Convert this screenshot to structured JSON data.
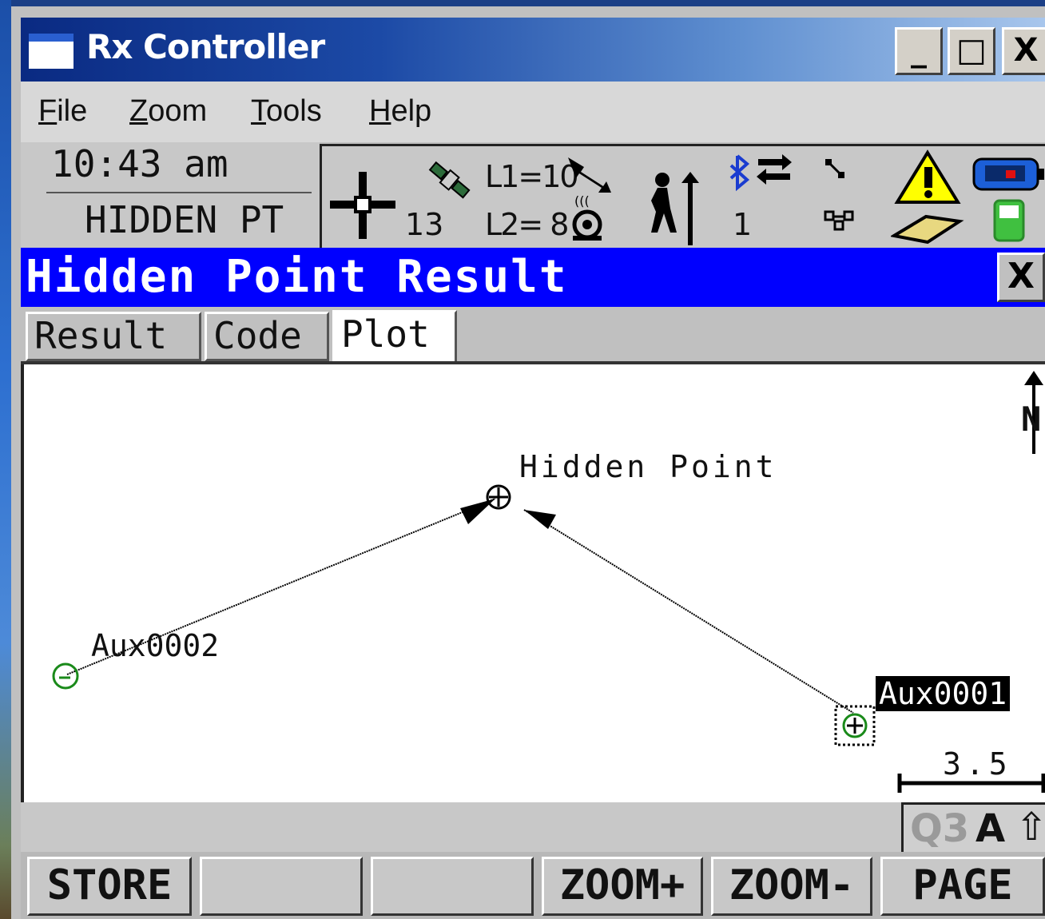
{
  "window": {
    "title": "Rx Controller",
    "minimize_label": "_",
    "maximize_label": "□",
    "close_label": "X"
  },
  "menu": [
    {
      "label": "File"
    },
    {
      "label": "Zoom"
    },
    {
      "label": "Tools"
    },
    {
      "label": "Help"
    }
  ],
  "status": {
    "time": "10:43 am",
    "mode": "HIDDEN PT",
    "satellites": "13",
    "l1": "L1=10",
    "l2": "L2= 8",
    "radio_count": "1",
    "icons": [
      "position-crosshair-icon",
      "satellite-icon",
      "radio-link-icon",
      "rover-pole-icon",
      "bluetooth-icon",
      "network-icon",
      "warning-icon",
      "battery-icon",
      "controller-icon"
    ]
  },
  "dialog": {
    "title": "Hidden Point Result",
    "close_label": "X"
  },
  "tabs": [
    {
      "label": "Result",
      "active": false
    },
    {
      "label": "Code",
      "active": false
    },
    {
      "label": "Plot",
      "active": true
    }
  ],
  "plot": {
    "north_label": "N",
    "scale_label": "3.5",
    "points": [
      {
        "name": "Hidden Point",
        "type": "computed"
      },
      {
        "name": "Aux0002",
        "type": "observed"
      },
      {
        "name": "Aux0001",
        "type": "observed",
        "selected": true
      }
    ]
  },
  "input_mode": {
    "q3": "Q3",
    "case": "A",
    "shift": "⇧"
  },
  "softkeys": [
    "STORE",
    "",
    "",
    "ZOOM+",
    "ZOOM-",
    "PAGE"
  ],
  "colors": {
    "dialog_header": "#0000ff",
    "observed_point": "#1a8a1a",
    "title_gradient_start": "#0a2a82"
  }
}
